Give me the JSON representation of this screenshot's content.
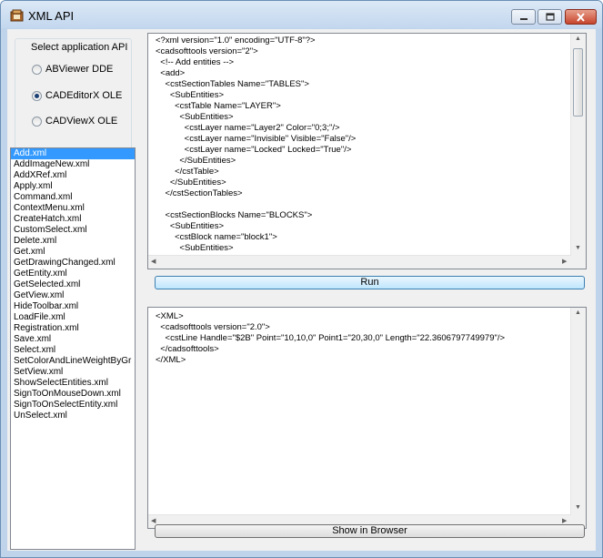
{
  "window": {
    "title": "XML API"
  },
  "api_group": {
    "title": "Select application API",
    "options": [
      {
        "label": "ABViewer DDE",
        "checked": false
      },
      {
        "label": "CADEditorX OLE",
        "checked": true
      },
      {
        "label": "CADViewX OLE",
        "checked": false
      }
    ]
  },
  "files": {
    "selected_index": 0,
    "items": [
      "Add.xml",
      "AddImageNew.xml",
      "AddXRef.xml",
      "Apply.xml",
      "Command.xml",
      "ContextMenu.xml",
      "CreateHatch.xml",
      "CustomSelect.xml",
      "Delete.xml",
      "Get.xml",
      "GetDrawingChanged.xml",
      "GetEntity.xml",
      "GetSelected.xml",
      "GetView.xml",
      "HideToolbar.xml",
      "LoadFile.xml",
      "Registration.xml",
      "Save.xml",
      "Select.xml",
      "SetColorAndLineWeightByGr",
      "SetView.xml",
      "ShowSelectEntities.xml",
      "SignToOnMouseDown.xml",
      "SignToOnSelectEntity.xml",
      "UnSelect.xml"
    ]
  },
  "editor": {
    "lines": [
      "<?xml version=\"1.0\" encoding=\"UTF-8\"?>",
      "<cadsofttools version=\"2\">",
      "  <!-- Add entities -->",
      "  <add>",
      "    <cstSectionTables Name=\"TABLES\">",
      "      <SubEntities>",
      "        <cstTable Name=\"LAYER\">",
      "          <SubEntities>",
      "            <cstLayer name=\"Layer2\" Color=\"0;3;\"/>",
      "            <cstLayer name=\"Invisible\" Visible=\"False\"/>",
      "            <cstLayer name=\"Locked\" Locked=\"True\"/>",
      "          </SubEntities>",
      "        </cstTable>",
      "      </SubEntities>",
      "    </cstSectionTables>",
      "",
      "    <cstSectionBlocks Name=\"BLOCKS\">",
      "      <SubEntities>",
      "        <cstBlock name=\"block1\">",
      "          <SubEntities>"
    ]
  },
  "run_button": {
    "label": "Run"
  },
  "output": {
    "lines": [
      "<XML>",
      "  <cadsofttools version=\"2.0\">",
      "    <cstLine Handle=\"$2B\" Point=\"10,10,0\" Point1=\"20,30,0\" Length=\"22.3606797749979\"/>",
      "  </cadsofttools>",
      "</XML>"
    ]
  },
  "browser_button": {
    "label": "Show in Browser"
  }
}
